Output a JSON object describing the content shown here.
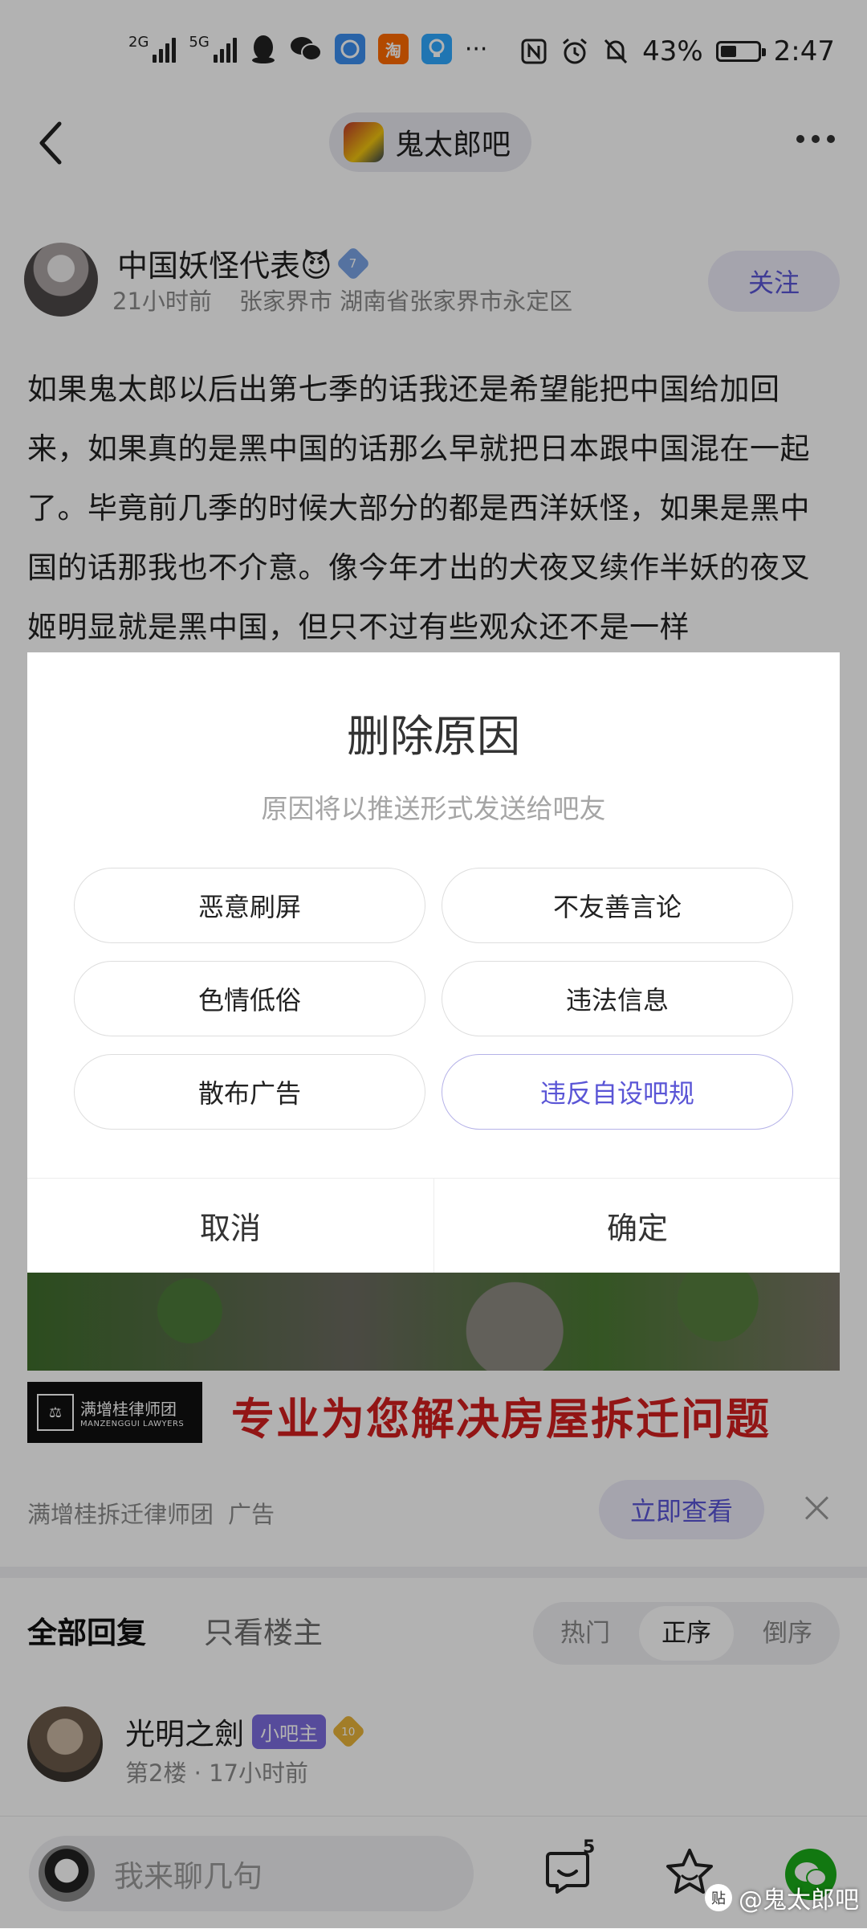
{
  "status_bar": {
    "signal1_label": "2G",
    "signal2_label": "5G",
    "app_taobao": "淘",
    "more_notifications": "···",
    "battery_text": "43%",
    "battery_level": 0.43,
    "time": "2:47"
  },
  "header": {
    "forum_name": "鬼太郎吧"
  },
  "post": {
    "author": "中国妖怪代表😈",
    "author_level": "7",
    "time_ago": "21小时前",
    "location": "张家界市 湖南省张家界市永定区",
    "follow_label": "关注",
    "content": "如果鬼太郎以后出第七季的话我还是希望能把中国给加回来，如果真的是黑中国的话那么早就把日本跟中国混在一起了。毕竟前几季的时候大部分的都是西洋妖怪，如果是黑中国的话那我也不介意。像今年才出的犬夜叉续作半妖的夜叉姬明显就是黑中国，但只不过有些观众还不是一样"
  },
  "ad": {
    "logo_cn": "满增桂律师团",
    "logo_en": "MANZENGGUI LAWYERS",
    "slogan": "专业为您解决房屋拆迁问题",
    "advertiser": "满增桂拆迁律师团",
    "ad_label": "广告",
    "cta": "立即查看"
  },
  "replies": {
    "tab_all": "全部回复",
    "tab_op_only": "只看楼主",
    "sort_hot": "热门",
    "sort_asc": "正序",
    "sort_desc": "倒序",
    "first": {
      "name": "光明之劍",
      "badge": "小吧主",
      "level": "10",
      "meta": "第2楼 · 17小时前"
    }
  },
  "bottom_bar": {
    "input_placeholder": "我来聊几句",
    "comment_count": "5",
    "watermark": "@鬼太郎吧",
    "watermark_icon": "贴"
  },
  "dialog": {
    "title": "删除原因",
    "subtitle": "原因将以推送形式发送给吧友",
    "reasons": [
      "恶意刷屏",
      "不友善言论",
      "色情低俗",
      "违法信息",
      "散布广告",
      "违反自设吧规"
    ],
    "selected_index": 5,
    "cancel": "取消",
    "confirm": "确定"
  },
  "colors": {
    "accent": "#5a55d6",
    "ad_red": "#d11f1f",
    "overlay": "rgba(0,0,0,0.30)"
  }
}
